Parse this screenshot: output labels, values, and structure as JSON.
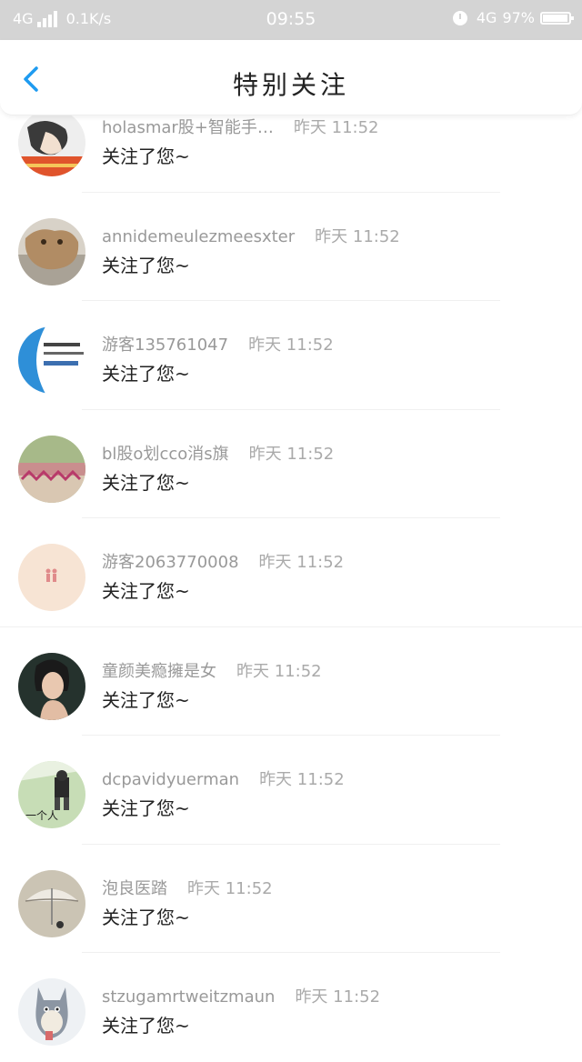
{
  "status_bar": {
    "network": "4G",
    "speed": "0.1K/s",
    "time": "09:55",
    "network_right": "4G",
    "battery": "97%",
    "battery_level": 0.97
  },
  "header": {
    "title": "特别关注"
  },
  "list": [
    {
      "name": "holasmar股+智能手…",
      "time": "昨天 11:52",
      "message": "关注了您~",
      "avatar_color": "#c9c9c9"
    },
    {
      "name": "annidemeulezmeesxter",
      "time": "昨天 11:52",
      "message": "关注了您~",
      "avatar_color": "#b89c7a"
    },
    {
      "name": "游客135761047",
      "time": "昨天 11:52",
      "message": "关注了您~",
      "avatar_color": "#3a8fd4"
    },
    {
      "name": "bl股o划cco消s旗",
      "time": "昨天 11:52",
      "message": "关注了您~",
      "avatar_color": "#9ab27c"
    },
    {
      "name": "游客2063770008",
      "time": "昨天 11:52",
      "message": "关注了您~",
      "avatar_color": "#f7e4d4"
    },
    {
      "name": "童颜美瘾擁是女",
      "time": "昨天 11:52",
      "message": "关注了您~",
      "avatar_color": "#2f3a35"
    },
    {
      "name": "dcpavidyuerman",
      "time": "昨天 11:52",
      "message": "关注了您~",
      "avatar_color": "#b9d3a8"
    },
    {
      "name": "泡良医踏",
      "time": "昨天 11:52",
      "message": "关注了您~",
      "avatar_color": "#cfc8b8"
    },
    {
      "name": "stzugamrtweitzmaun",
      "time": "昨天 11:52",
      "message": "关注了您~",
      "avatar_color": "#d9dde3"
    }
  ],
  "avatar_text": {
    "item_4": "一个人"
  }
}
